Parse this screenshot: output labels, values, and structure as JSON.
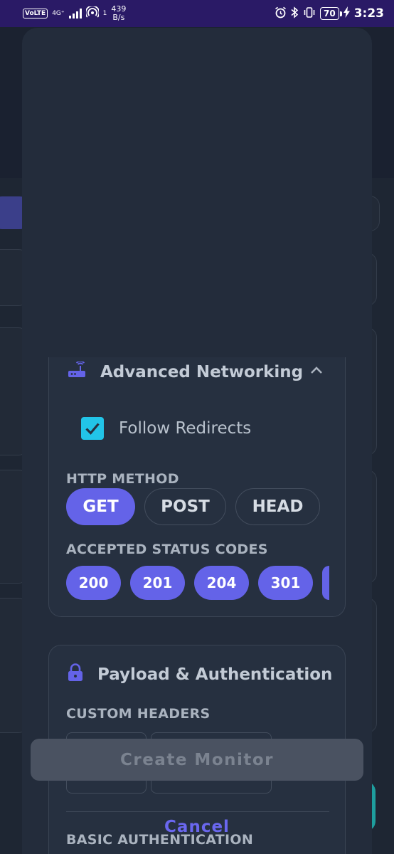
{
  "status_bar": {
    "volte": "VoLTE",
    "network": "4G⁺",
    "hotspot_count": "1",
    "speed_value": "439",
    "speed_unit": "B/s",
    "battery": "70",
    "time": "3:23"
  },
  "advanced_networking": {
    "title": "Advanced Networking",
    "follow_redirects_label": "Follow Redirects",
    "follow_redirects_checked": true,
    "http_method_label": "HTTP METHOD",
    "methods": [
      "GET",
      "POST",
      "HEAD"
    ],
    "selected_method": "GET",
    "status_codes_label": "ACCEPTED STATUS CODES",
    "status_codes": [
      "200",
      "201",
      "204",
      "301"
    ]
  },
  "payload_auth": {
    "title": "Payload & Authentication",
    "custom_headers_label": "CUSTOM HEADERS",
    "basic_auth_label": "BASIC AUTHENTICATION"
  },
  "actions": {
    "create_label": "Create Monitor",
    "cancel_label": "Cancel"
  },
  "colors": {
    "accent": "#6463e8",
    "checkbox": "#22c4e8",
    "status_bar": "#2a1a66"
  }
}
